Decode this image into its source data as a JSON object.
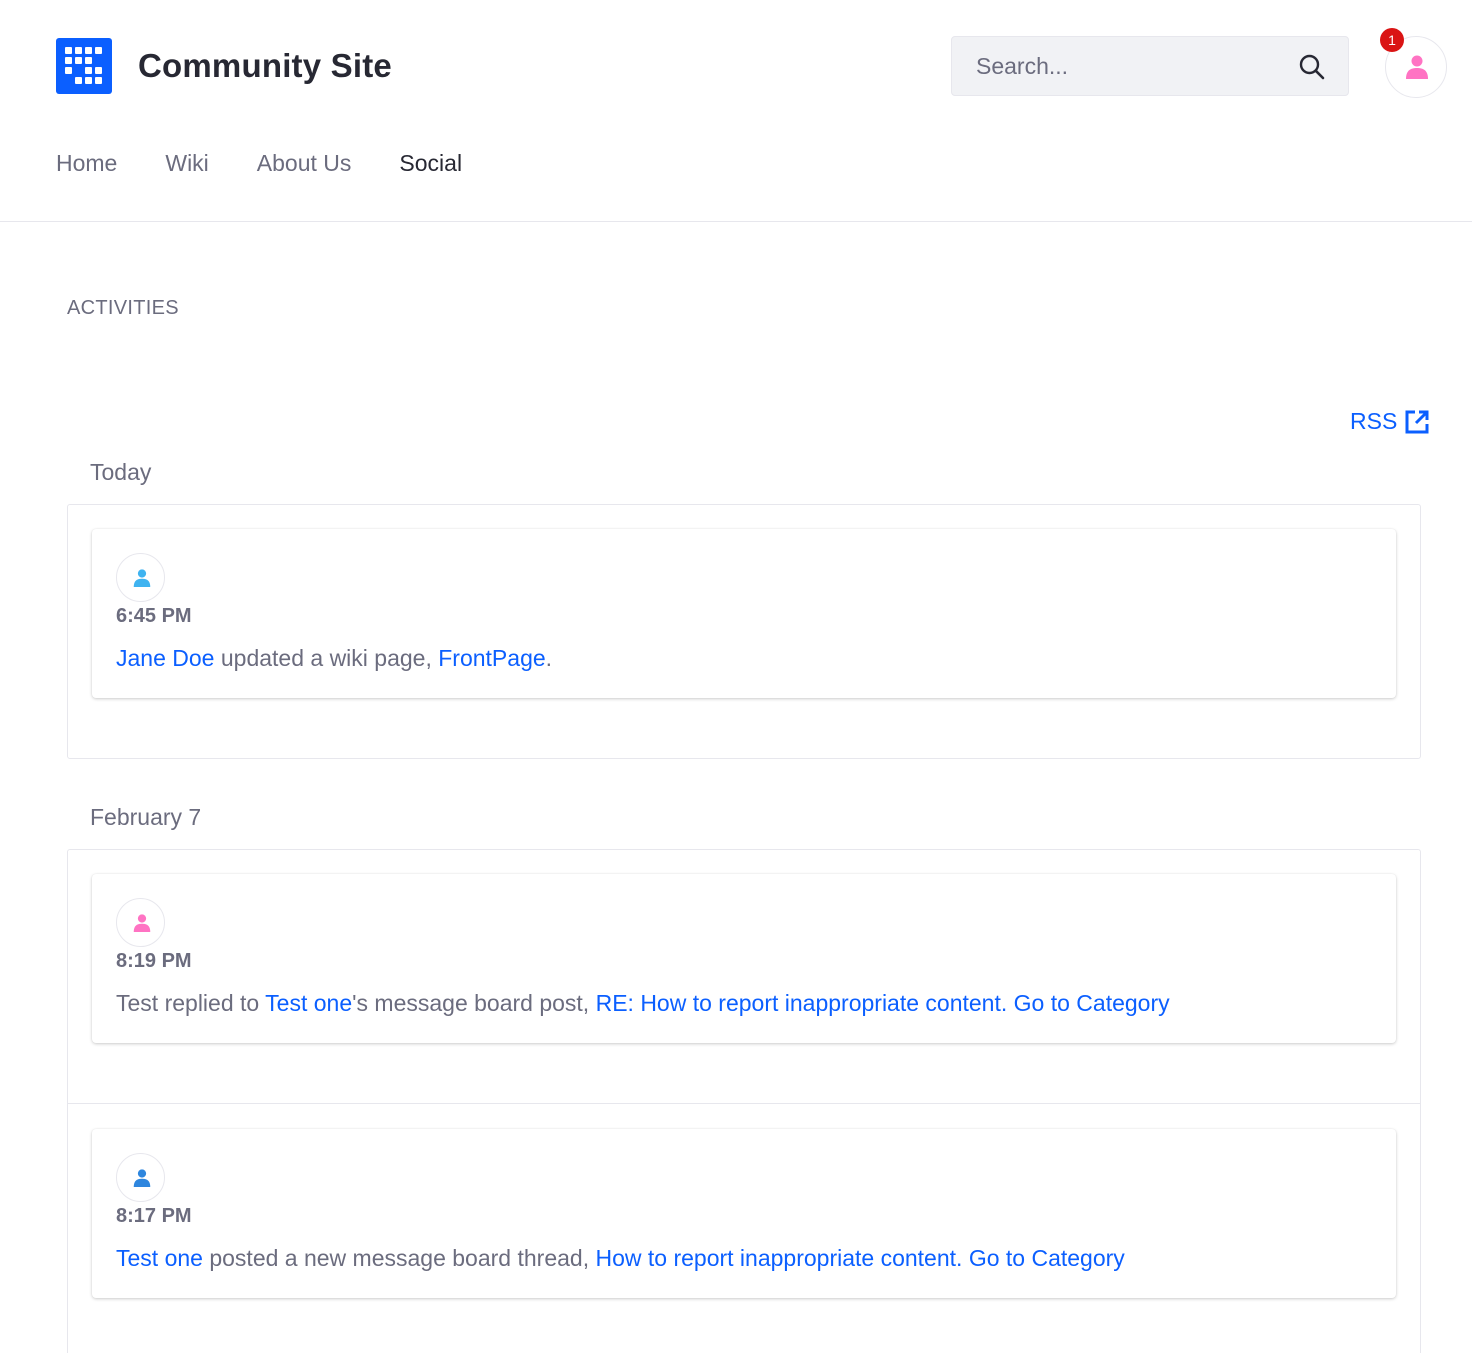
{
  "header": {
    "site_title": "Community Site",
    "search_placeholder": "Search...",
    "notification_count": "1",
    "nav": [
      {
        "label": "Home"
      },
      {
        "label": "Wiki"
      },
      {
        "label": "About Us"
      },
      {
        "label": "Social",
        "active": true
      }
    ]
  },
  "activities": {
    "title": "ACTIVITIES",
    "rss_label": "RSS",
    "groups": [
      {
        "day": "Today",
        "items": [
          {
            "time": "6:45 PM",
            "avatar_color": "#3fb3f0",
            "parts": [
              {
                "text": "Jane Doe",
                "link": true
              },
              {
                "text": " updated a wiki page, ",
                "link": false
              },
              {
                "text": "FrontPage",
                "link": true
              },
              {
                "text": ".",
                "link": false
              }
            ]
          }
        ]
      },
      {
        "day": "February 7",
        "items": [
          {
            "time": "8:19 PM",
            "avatar_color": "#ff73c3",
            "parts": [
              {
                "text": "Test replied to ",
                "link": false
              },
              {
                "text": "Test one",
                "link": true
              },
              {
                "text": "'s message board post, ",
                "link": false
              },
              {
                "text": "RE: How to report inappropriate content.",
                "link": true
              },
              {
                "text": " ",
                "link": false
              },
              {
                "text": "Go to Category",
                "link": true
              }
            ]
          },
          {
            "time": "8:17 PM",
            "avatar_color": "#2e86de",
            "parts": [
              {
                "text": "Test one",
                "link": true
              },
              {
                "text": " posted a new message board thread, ",
                "link": false
              },
              {
                "text": "How to report inappropriate content.",
                "link": true
              },
              {
                "text": " ",
                "link": false
              },
              {
                "text": "Go to Category",
                "link": true
              }
            ]
          }
        ]
      }
    ]
  },
  "colors": {
    "brand": "#0b5fff",
    "user_avatar": "#ff73c3",
    "badge": "#da1414"
  }
}
